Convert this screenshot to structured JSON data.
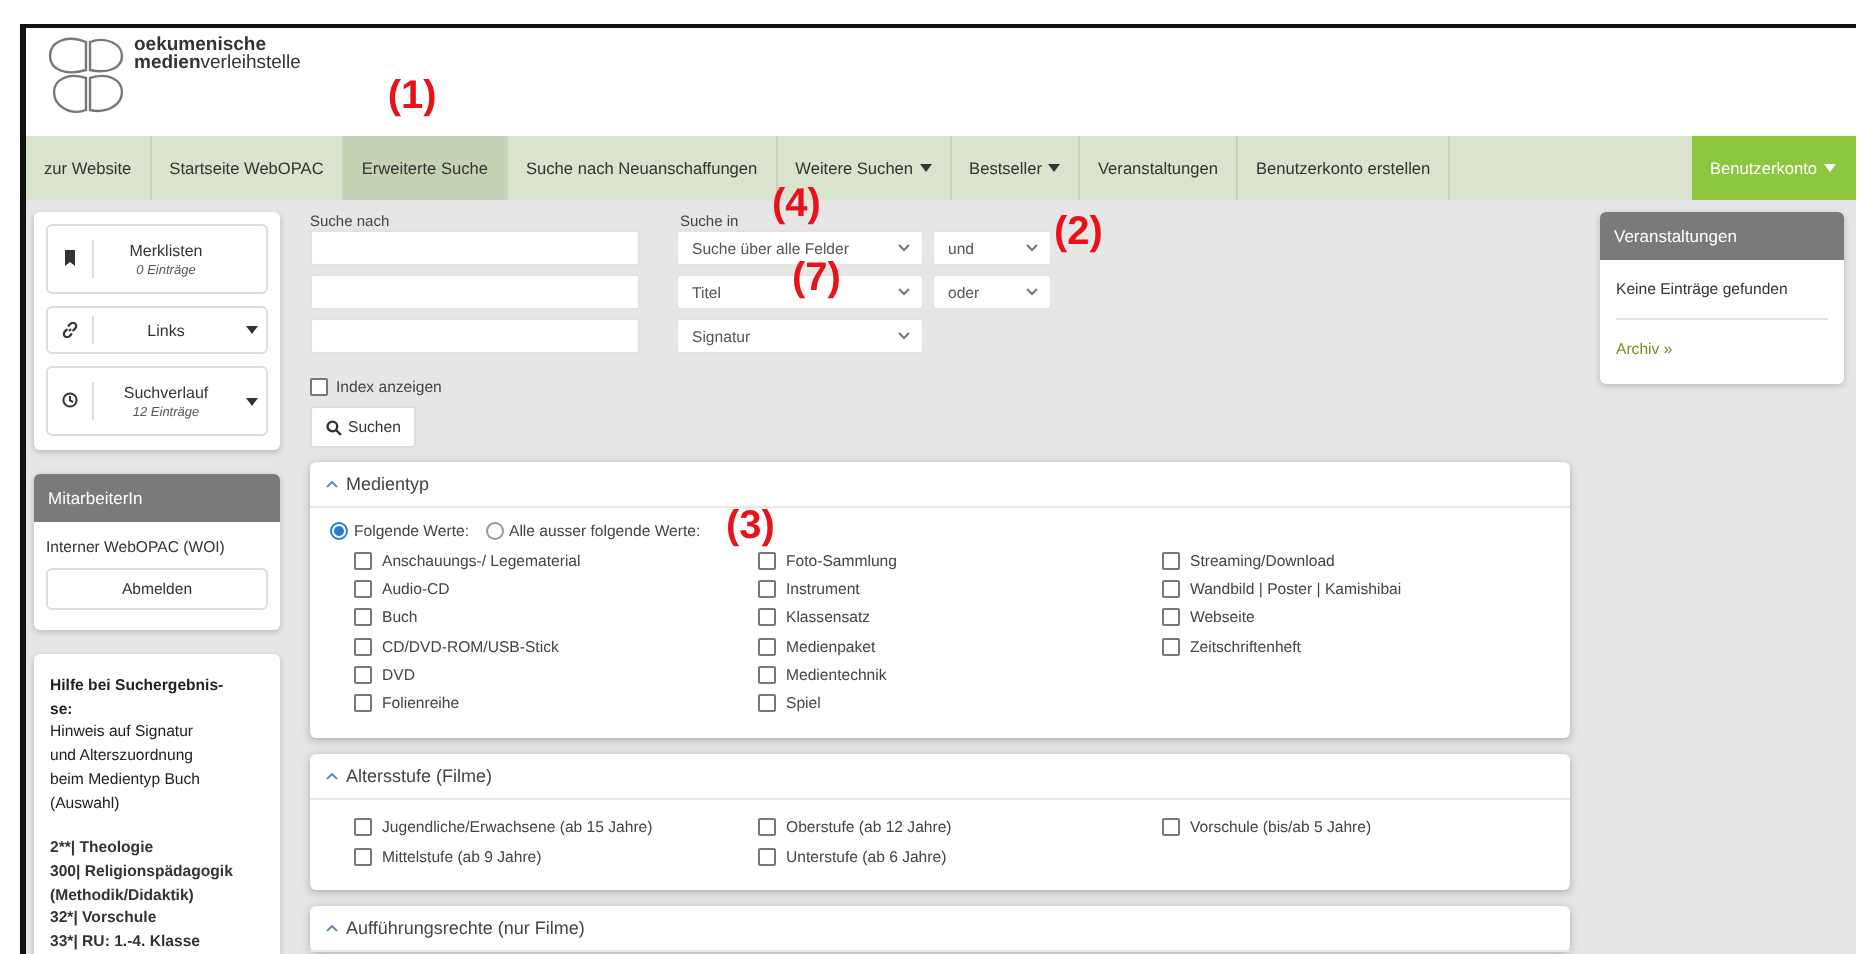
{
  "logo": {
    "line1": "oekumenische",
    "line2": "**medien**verleihstelle"
  },
  "nav": {
    "items": [
      {
        "label": "zur Website",
        "selected": false,
        "dropdown": false
      },
      {
        "label": "Startseite WebOPAC",
        "selected": false,
        "dropdown": false
      },
      {
        "label": "Erweiterte Suche",
        "selected": true,
        "dropdown": false,
        "annotation": "(1)"
      },
      {
        "label": "Suche nach Neuanschaffungen",
        "selected": false,
        "dropdown": false
      },
      {
        "label": "Weitere Suchen",
        "selected": false,
        "dropdown": true
      },
      {
        "label": "Bestseller",
        "selected": false,
        "dropdown": true
      },
      {
        "label": "Veranstaltungen",
        "selected": false,
        "dropdown": false
      },
      {
        "label": "Benutzerkonto erstellen",
        "selected": false,
        "dropdown": false
      }
    ],
    "account": {
      "label": "Benutzerkonto",
      "dropdown": true
    }
  },
  "sidebar": {
    "tools": [
      {
        "kind": "bookmark",
        "label": "Merklisten",
        "sub": "0 Einträge",
        "dropdown": false
      },
      {
        "kind": "link",
        "label": "Links",
        "dropdown": true
      },
      {
        "kind": "history",
        "label": "Suchverlauf",
        "sub": "12 Einträge",
        "dropdown": true
      }
    ],
    "staff": {
      "title": "MitarbeiterIn",
      "text": "Interner WebOPAC (WOI)",
      "button": "Abmelden"
    },
    "help": {
      "heading": [
        "Hilfe bei Suchergebnis-",
        "se:"
      ],
      "intro": [
        "Hinweis auf Signatur",
        "und Alterszuordnung",
        "beim Medientyp Buch",
        "(Auswahl)"
      ],
      "entries": [
        "2**| Theologie",
        "300| Religionspädagogik",
        "(Methodik/Didaktik)",
        "32*| Vorschule",
        "33*| RU: 1.-4. Klasse"
      ]
    }
  },
  "search": {
    "query_label": "Suche nach",
    "field_label": "Suche in",
    "rows": [
      {
        "field": "Suche über alle Felder",
        "field_annotation": "(4)",
        "operator": "und",
        "operator_annotation": "(2)"
      },
      {
        "field": "Titel",
        "field_annotation": "(7)",
        "operator": "oder"
      },
      {
        "field": "Signatur"
      }
    ],
    "index": {
      "label": "Index anzeigen",
      "checked": false
    },
    "button": "Suchen"
  },
  "facets": [
    {
      "title": "Medientyp",
      "expanded": true,
      "annotation": "(3)",
      "modes": [
        {
          "label": "Folgende Werte:",
          "selected": true
        },
        {
          "label": "Alle ausser folgende Werte:",
          "selected": false
        }
      ],
      "columns": [
        [
          {
            "label": "Anschauungs-/ Legematerial",
            "checked": false
          },
          {
            "label": "Audio-CD",
            "checked": false
          },
          {
            "label": "Buch",
            "checked": false
          },
          {
            "label": "CD/DVD-ROM/USB-Stick",
            "checked": false
          },
          {
            "label": "DVD",
            "checked": false
          },
          {
            "label": "Folienreihe",
            "checked": false
          }
        ],
        [
          {
            "label": "Foto-Sammlung",
            "checked": false
          },
          {
            "label": "Instrument",
            "checked": false
          },
          {
            "label": "Klassensatz",
            "checked": false
          },
          {
            "label": "Medienpaket",
            "checked": false
          },
          {
            "label": "Medientechnik",
            "checked": false
          },
          {
            "label": "Spiel",
            "checked": false
          }
        ],
        [
          {
            "label": "Streaming/Download",
            "checked": false
          },
          {
            "label": "Wandbild | Poster | Kamishibai",
            "checked": false
          },
          {
            "label": "Webseite",
            "checked": false
          },
          {
            "label": "Zeitschriftenheft",
            "checked": false
          }
        ]
      ]
    },
    {
      "title": "Altersstufe (Filme)",
      "expanded": true,
      "columns": [
        [
          {
            "label": "Jugendliche/Erwachsene (ab 15 Jahre)",
            "checked": false
          },
          {
            "label": "Mittelstufe (ab 9 Jahre)",
            "checked": false
          }
        ],
        [
          {
            "label": "Oberstufe (ab 12 Jahre)",
            "checked": false
          },
          {
            "label": "Unterstufe (ab 6 Jahre)",
            "checked": false
          }
        ],
        [
          {
            "label": "Vorschule (bis/ab 5 Jahre)",
            "checked": false
          }
        ]
      ]
    },
    {
      "title": "Aufführungsrechte (nur Filme)",
      "expanded": true
    }
  ],
  "events": {
    "title": "Veranstaltungen",
    "text": "Keine Einträge gefunden",
    "link": "Archiv »"
  }
}
